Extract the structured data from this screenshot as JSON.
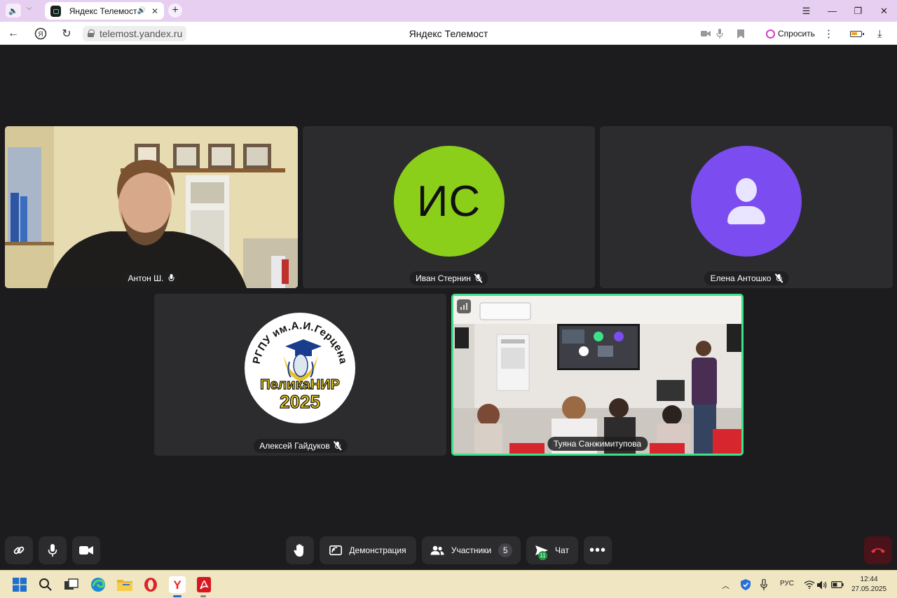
{
  "browser": {
    "tab_title": "Яндекс Телемост",
    "url": "telemost.yandex.ru",
    "page_title": "Яндекс Телемост",
    "ask_label": "Спросить"
  },
  "participants": [
    {
      "name": "Антон Ш.",
      "mic": "on",
      "video": "camera"
    },
    {
      "name": "Иван Стернин",
      "mic": "muted",
      "video": "avatar",
      "initials": "ИС",
      "avatar_color": "#8bcf1a"
    },
    {
      "name": "Елена Антошко",
      "mic": "muted",
      "video": "avatar",
      "avatar_color": "#7b4cf0"
    },
    {
      "name": "Алексей Гайдуков",
      "mic": "muted",
      "video": "logo",
      "logo_text": {
        "top": "РГПУ им.А.И.Герцена",
        "middle": "ПеликаНИР",
        "bottom": "2025"
      }
    },
    {
      "name": "Туяна Санжимитупова",
      "mic": "on",
      "video": "camera",
      "speaking": true
    }
  ],
  "controls": {
    "demo_label": "Демонстрация",
    "participants_label": "Участники",
    "participants_count": "5",
    "chat_label": "Чат",
    "chat_unread": "11"
  },
  "taskbar": {
    "lang": "РУС",
    "time": "12:44",
    "date": "27.05.2025"
  },
  "colors": {
    "speaking_border": "#3fe08a",
    "hangup": "#e0333f"
  }
}
